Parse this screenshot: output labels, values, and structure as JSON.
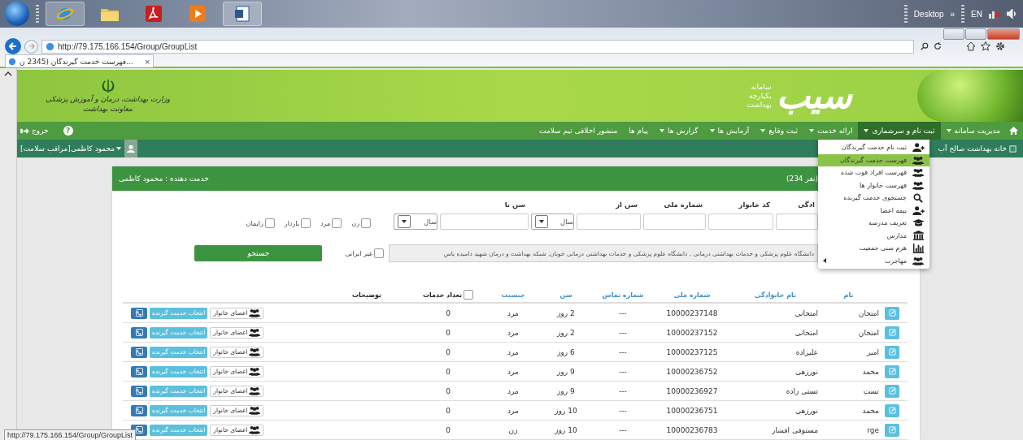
{
  "taskbar": {
    "desktop_label": "Desktop",
    "chevron": "»",
    "language": "EN"
  },
  "browser": {
    "url": "http://79.175.166.154/Group/GroupList",
    "tab_title": "...فهرست خدمت گیرندگان (2345 ن",
    "tab_close": "×"
  },
  "header": {
    "ministry_lines": [
      "وزارت بهداشت، درمان و آموزش پزشکی",
      "معاونت بهداشت"
    ],
    "system_lines": [
      "سامانه",
      "یکپارچه",
      "بهداشت"
    ],
    "logo_text": "سیب"
  },
  "nav": {
    "items": [
      {
        "label": "مدیریت سامانه",
        "dropdown": true,
        "selected": false
      },
      {
        "label": "ثبت نام و سرشماری",
        "dropdown": true,
        "selected": true
      },
      {
        "label": "ارائه خدمت",
        "dropdown": true,
        "selected": false
      },
      {
        "label": "ثبت وقایع",
        "dropdown": true,
        "selected": false
      },
      {
        "label": "آزمایش ها",
        "dropdown": true,
        "selected": false
      },
      {
        "label": "گزارش ها",
        "dropdown": true,
        "selected": false
      },
      {
        "label": "پیام ها",
        "dropdown": false,
        "selected": false
      },
      {
        "label": "منشور اخلاقی تیم سلامت",
        "dropdown": false,
        "selected": false
      }
    ],
    "logout": "خروج",
    "help": "?"
  },
  "user_bar": {
    "user": "محمود کاظمی[مراقب سلامت]",
    "facility": "خانه بهداشت صالح آب"
  },
  "card": {
    "title": "خدمت دهنده : محمود کاظمی",
    "count": "(234 نفر)"
  },
  "filters": {
    "fields": [
      {
        "label": "ادگی",
        "kind": "text"
      },
      {
        "label": "کد خانوار",
        "kind": "text"
      },
      {
        "label": "شماره ملی",
        "kind": "text"
      },
      {
        "label": "سن از",
        "kind": "age",
        "unit": "سال"
      },
      {
        "label": "سن تا",
        "kind": "age",
        "unit": "سال"
      }
    ],
    "checkboxes": [
      {
        "label": "زن",
        "checked": false
      },
      {
        "label": "مرد",
        "checked": false
      },
      {
        "label": "باردار",
        "checked": false
      },
      {
        "label": "زایمان",
        "checked": false
      }
    ],
    "university": "دانشگاه علوم پزشکی و خدمات بهداشتی درمانی , دانشگاه علوم پزشکی و خدمات بهداشتی درمانی خوبان, شبکه بهداشت و درمان شهید دامیده یاس",
    "non_iranian": {
      "label": "غیر ایرانی",
      "checked": false
    },
    "search_button": "جستجو"
  },
  "table": {
    "columns": [
      "نام",
      "نام خانوادگی",
      "شماره ملی",
      "شماره تماس",
      "سن",
      "جنسیت",
      "تعداد خدمات",
      "توضیحات"
    ],
    "count_checked": false,
    "rows": [
      {
        "first_name": "امتحان",
        "last_name": "امتحانی",
        "national_id": "10000237148",
        "phone": "---",
        "age": "2 روز",
        "gender": "مرد",
        "services": "0",
        "family_button": "اعضای خانوار",
        "select_button": "انتخاب خدمت گیرنده"
      },
      {
        "first_name": "امتحان",
        "last_name": "امتحانی",
        "national_id": "10000237152",
        "phone": "---",
        "age": "2 روز",
        "gender": "مرد",
        "services": "0",
        "family_button": "اعضای خانوار",
        "select_button": "انتخاب خدمت گیرنده"
      },
      {
        "first_name": "امیر",
        "last_name": "علیزاده",
        "national_id": "10000237125",
        "phone": "---",
        "age": "6 روز",
        "gender": "مرد",
        "services": "0",
        "family_button": "اعضای خانوار",
        "select_button": "انتخاب خدمت گیرنده"
      },
      {
        "first_name": "محمد",
        "last_name": "نورزهی",
        "national_id": "10000236752",
        "phone": "---",
        "age": "9 روز",
        "gender": "مرد",
        "services": "0",
        "family_button": "اعضای خانوار",
        "select_button": "انتخاب خدمت گیرنده"
      },
      {
        "first_name": "تست",
        "last_name": "تستی زاده",
        "national_id": "10000236927",
        "phone": "---",
        "age": "9 روز",
        "gender": "مرد",
        "services": "0",
        "family_button": "اعضای خانوار",
        "select_button": "انتخاب خدمت گیرنده"
      },
      {
        "first_name": "محمد",
        "last_name": "نورزهی",
        "national_id": "10000236751",
        "phone": "---",
        "age": "10 روز",
        "gender": "مرد",
        "services": "0",
        "family_button": "اعضای خانوار",
        "select_button": "انتخاب خدمت گیرنده"
      },
      {
        "first_name": "rge",
        "last_name": "مستوفی افشار",
        "national_id": "10000236783",
        "phone": "---",
        "age": "10 روز",
        "gender": "زن",
        "services": "0",
        "family_button": "اعضای خانوار",
        "select_button": "انتخاب خدمت گیرنده"
      }
    ]
  },
  "menu": {
    "items": [
      {
        "label": "ثبت نام خدمت گیرندگان",
        "kind": "add",
        "selected": false,
        "submenu": false
      },
      {
        "label": "فهرست خدمت گیرندگان",
        "kind": "group",
        "selected": true,
        "submenu": false
      },
      {
        "label": "فهرست افراد فوت شده",
        "kind": "group",
        "selected": false,
        "submenu": false
      },
      {
        "label": "فهرست خانوار ها",
        "kind": "group",
        "selected": false,
        "submenu": false
      },
      {
        "label": "جستجوی خدمت گیرنده",
        "kind": "search",
        "selected": false,
        "submenu": false
      },
      {
        "label": "بیمه اعضا",
        "kind": "add",
        "selected": false,
        "submenu": false
      },
      {
        "label": "تعریف مدرسه",
        "kind": "school",
        "selected": false,
        "submenu": false
      },
      {
        "label": "مدارس",
        "kind": "building",
        "selected": false,
        "submenu": false
      },
      {
        "label": "هرم سنی جمعیت",
        "kind": "chart",
        "selected": false,
        "submenu": false
      },
      {
        "label": "مهاجرت",
        "kind": "group",
        "selected": false,
        "submenu": true
      }
    ]
  },
  "status_bar": "http://79.175.166.154/Group/GroupList"
}
